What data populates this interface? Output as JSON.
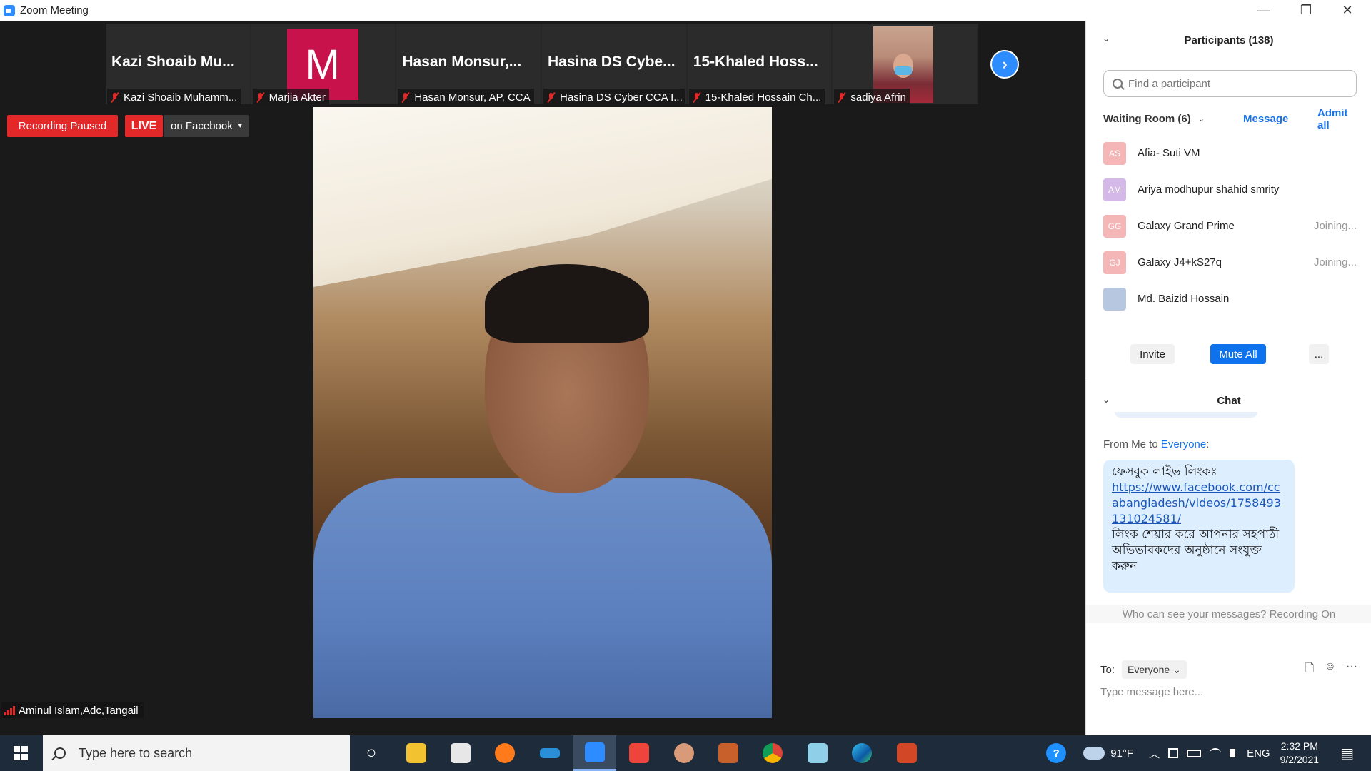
{
  "window": {
    "title": "Zoom Meeting",
    "minimize": "—",
    "restore": "❐",
    "close": "✕"
  },
  "tiles": [
    {
      "big": "Kazi Shoaib Mu...",
      "label": "Kazi Shoaib Muhamm..."
    },
    {
      "avatar_letter": "M",
      "label": "Marjia Akter"
    },
    {
      "big": "Hasan Monsur,...",
      "label": "Hasan Monsur, AP, CCA"
    },
    {
      "big": "Hasina DS Cybe...",
      "label": "Hasina DS Cyber CCA I..."
    },
    {
      "big": "15-Khaled Hoss...",
      "label": "15-Khaled Hossain Ch..."
    },
    {
      "label": "sadiya Afrin"
    }
  ],
  "next_arrow": "›",
  "status": {
    "recording": "Recording Paused",
    "live": "LIVE",
    "live_target": "on Facebook",
    "caret": "▾"
  },
  "speaker": {
    "name": "Aminul Islam,Adc,Tangail"
  },
  "participants": {
    "title": "Participants (138)",
    "collapse": "⌄",
    "search_placeholder": "Find a participant",
    "waiting_room": "Waiting Room (6)",
    "waiting_chevron": "⌄",
    "message": "Message",
    "admit_all": "Admit all",
    "list": [
      {
        "initials": "AS",
        "name": "Afia- Suti VM",
        "status": "",
        "color": "#f4b6b6"
      },
      {
        "initials": "AM",
        "name": "Ariya modhupur shahid smrity",
        "status": "",
        "color": "#d4b8e8"
      },
      {
        "initials": "GG",
        "name": "Galaxy Grand Prime",
        "status": "Joining...",
        "color": "#f4b6b6"
      },
      {
        "initials": "GJ",
        "name": "Galaxy J4+kS27q",
        "status": "Joining...",
        "color": "#f4b6b6"
      },
      {
        "initials": "",
        "name": "Md. Baizid Hossain",
        "status": "",
        "color": "#b7c7e0"
      }
    ],
    "invite": "Invite",
    "mute_all": "Mute All",
    "more": "..."
  },
  "chat": {
    "title": "Chat",
    "collapse": "⌄",
    "from_prefix": "From Me to ",
    "from_to": "Everyone",
    "from_suffix": ":",
    "line1": "ফেসবুক লাইভ লিংকঃ",
    "link": "https://www.facebook.com/ccabangladesh/videos/1758493131024581/",
    "line3": "লিংক শেয়ার করে আপনার সহপাঠী অভিভাবকদের অনুষ্ঠানে সংযুক্ত করুন",
    "who_can_see": "Who can see your messages? Recording On",
    "to_label": "To:",
    "to_value": "Everyone",
    "to_caret": "⌄",
    "placeholder": "Type message here...",
    "file_icon": "🗋",
    "emoji_icon": "☺",
    "more_icon": "···"
  },
  "taskbar": {
    "search_placeholder": "Type here to search",
    "weather": "91°F",
    "lang": "ENG",
    "time": "2:32 PM",
    "date": "9/2/2021",
    "cortana": "○",
    "help": "?",
    "chevron_up": "︿",
    "notification": "▤"
  }
}
